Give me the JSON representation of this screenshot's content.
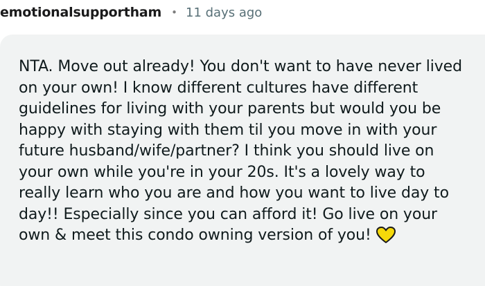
{
  "comment": {
    "username": "emotionalsupportham",
    "separator": "•",
    "timestamp": "11 days ago",
    "body_lines": [
      "NTA. Move out already! You don't want to have never lived",
      "on your own! I know different cultures have different",
      "guidelines for living with your parents but would you be",
      "happy with staying with them til you move in with your",
      "future husband/wife/partner? I think you should live on",
      "your own while you're in your 20s. It's a lovely way to",
      "really learn who you are and how you want to live day to",
      "day!! Especially since you can afford it! Go live on your",
      "own & meet this condo owning version of you!"
    ],
    "emoji": "yellow-heart-icon"
  },
  "colors": {
    "bubble_background": "#f1f3f3",
    "username": "#1a1a1b",
    "timestamp": "#576f76",
    "body_text": "#0f1a1c",
    "heart_fill": "#f5d90a",
    "heart_stroke": "#1a1a1b"
  }
}
